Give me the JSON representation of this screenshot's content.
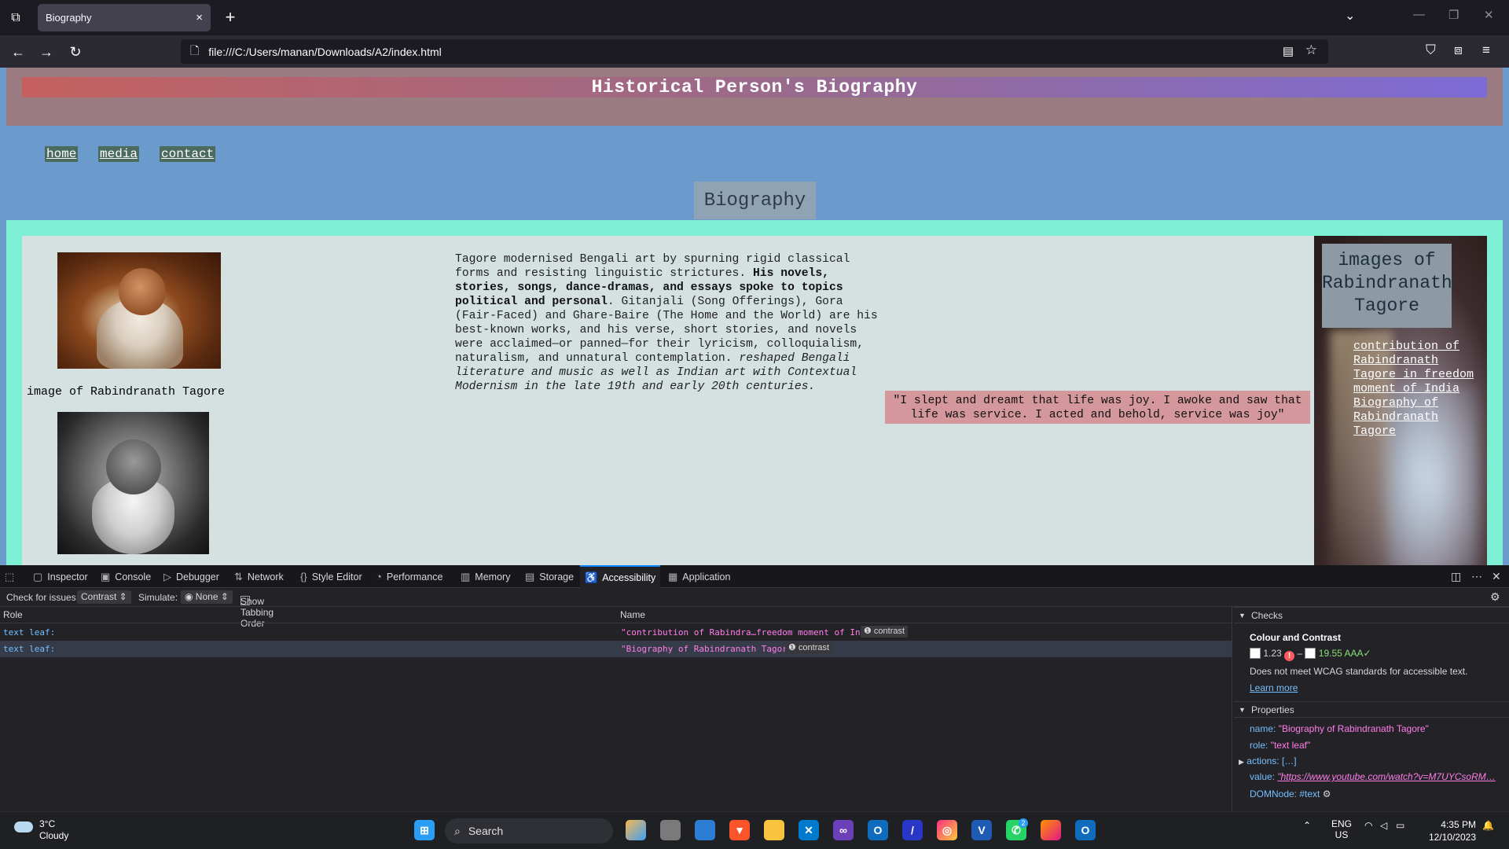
{
  "browser": {
    "tab_title": "Biography",
    "tab_close": "×",
    "new_tab": "+",
    "url": "file:///C:/Users/manan/Downloads/A2/index.html"
  },
  "page": {
    "header_title": "Historical Person's Biography",
    "menu": [
      "home",
      "media",
      "contact"
    ],
    "section_heading": "Biography",
    "caption1": "image of Rabindranath Tagore",
    "bio_plain1": "Tagore modernised Bengali art by spurning rigid classical forms and resisting linguistic strictures. ",
    "bio_bold": "His novels, stories, songs, dance-dramas, and essays spoke to topics political and personal",
    "bio_plain2": ". Gitanjali (Song Offerings), Gora (Fair-Faced) and Ghare-Baire (The Home and the World) are his best-known works, and his verse, short stories, and novels were acclaimed—or panned—for their lyricism, colloquialism, naturalism, and unnatural contemplation. ",
    "bio_italic": "reshaped Bengali literature and music as well as Indian art with Contextual Modernism in the late 19th and early 20th centuries.",
    "quote": "\"I slept and dreamt that life was joy. I awoke and saw that life was service. I acted and behold, service was joy\"",
    "side_title": "images of Rabindranath Tagore",
    "side_links": [
      "contribution of Rabindranath Tagore in freedom moment of India",
      "Biography of Rabindranath Tagore"
    ]
  },
  "devtools": {
    "tabs": [
      "Inspector",
      "Console",
      "Debugger",
      "Network",
      "Style Editor",
      "Performance",
      "Memory",
      "Storage",
      "Accessibility",
      "Application"
    ],
    "active_tab": "Accessibility",
    "check_label": "Check for issues:",
    "check_value": "Contrast ⇕",
    "simulate_label": "Simulate:",
    "simulate_value": "◉ None ⇕",
    "tabbing_label": "Show Tabbing Order",
    "col_role": "Role",
    "col_name": "Name",
    "rows": [
      {
        "role": "text leaf:",
        "name": "\"contribution of Rabindra…freedom moment of India\"",
        "badge": "❶ contrast"
      },
      {
        "role": "text leaf:",
        "name": "\"Biography of Rabindranath Tagore\"",
        "badge": "❶ contrast"
      }
    ],
    "checks_header": "Checks",
    "contrast_title": "Colour and Contrast",
    "contrast_low": "1.23",
    "contrast_high": "19.55 AAA✓",
    "contrast_dash": "–",
    "contrast_msg": "Does not meet WCAG standards for accessible text.",
    "learn_more": "Learn more",
    "properties_header": "Properties",
    "prop_name_key": "name:",
    "prop_name_val": "\"Biography of Rabindranath Tagore\"",
    "prop_role_key": "role:",
    "prop_role_val": "\"text leaf\"",
    "prop_actions": "actions: […]",
    "prop_value_key": "value:",
    "prop_value_val": "\"https://www.youtube.com/watch?v=M7UYCsoRM…",
    "prop_domnode": "DOMNode: #text"
  },
  "taskbar": {
    "temp": "3°C",
    "weather": "Cloudy",
    "search": "Search",
    "lang1": "ENG",
    "lang2": "US",
    "time": "4:35 PM",
    "date": "12/10/2023",
    "whatsapp_badge": "2"
  }
}
